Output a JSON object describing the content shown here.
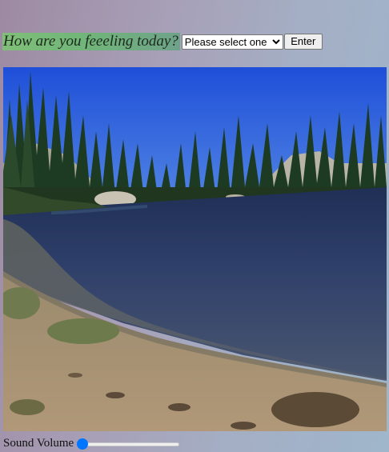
{
  "prompt": {
    "question": "How are you feeeling today?",
    "select_value": "Please select one",
    "select_icon": "chevron-down-icon",
    "enter_label": "Enter"
  },
  "scene": {
    "description_icon": "lake-landscape-image"
  },
  "volume": {
    "label": "Sound Volume",
    "level": 0,
    "accent": "#0075ff"
  }
}
